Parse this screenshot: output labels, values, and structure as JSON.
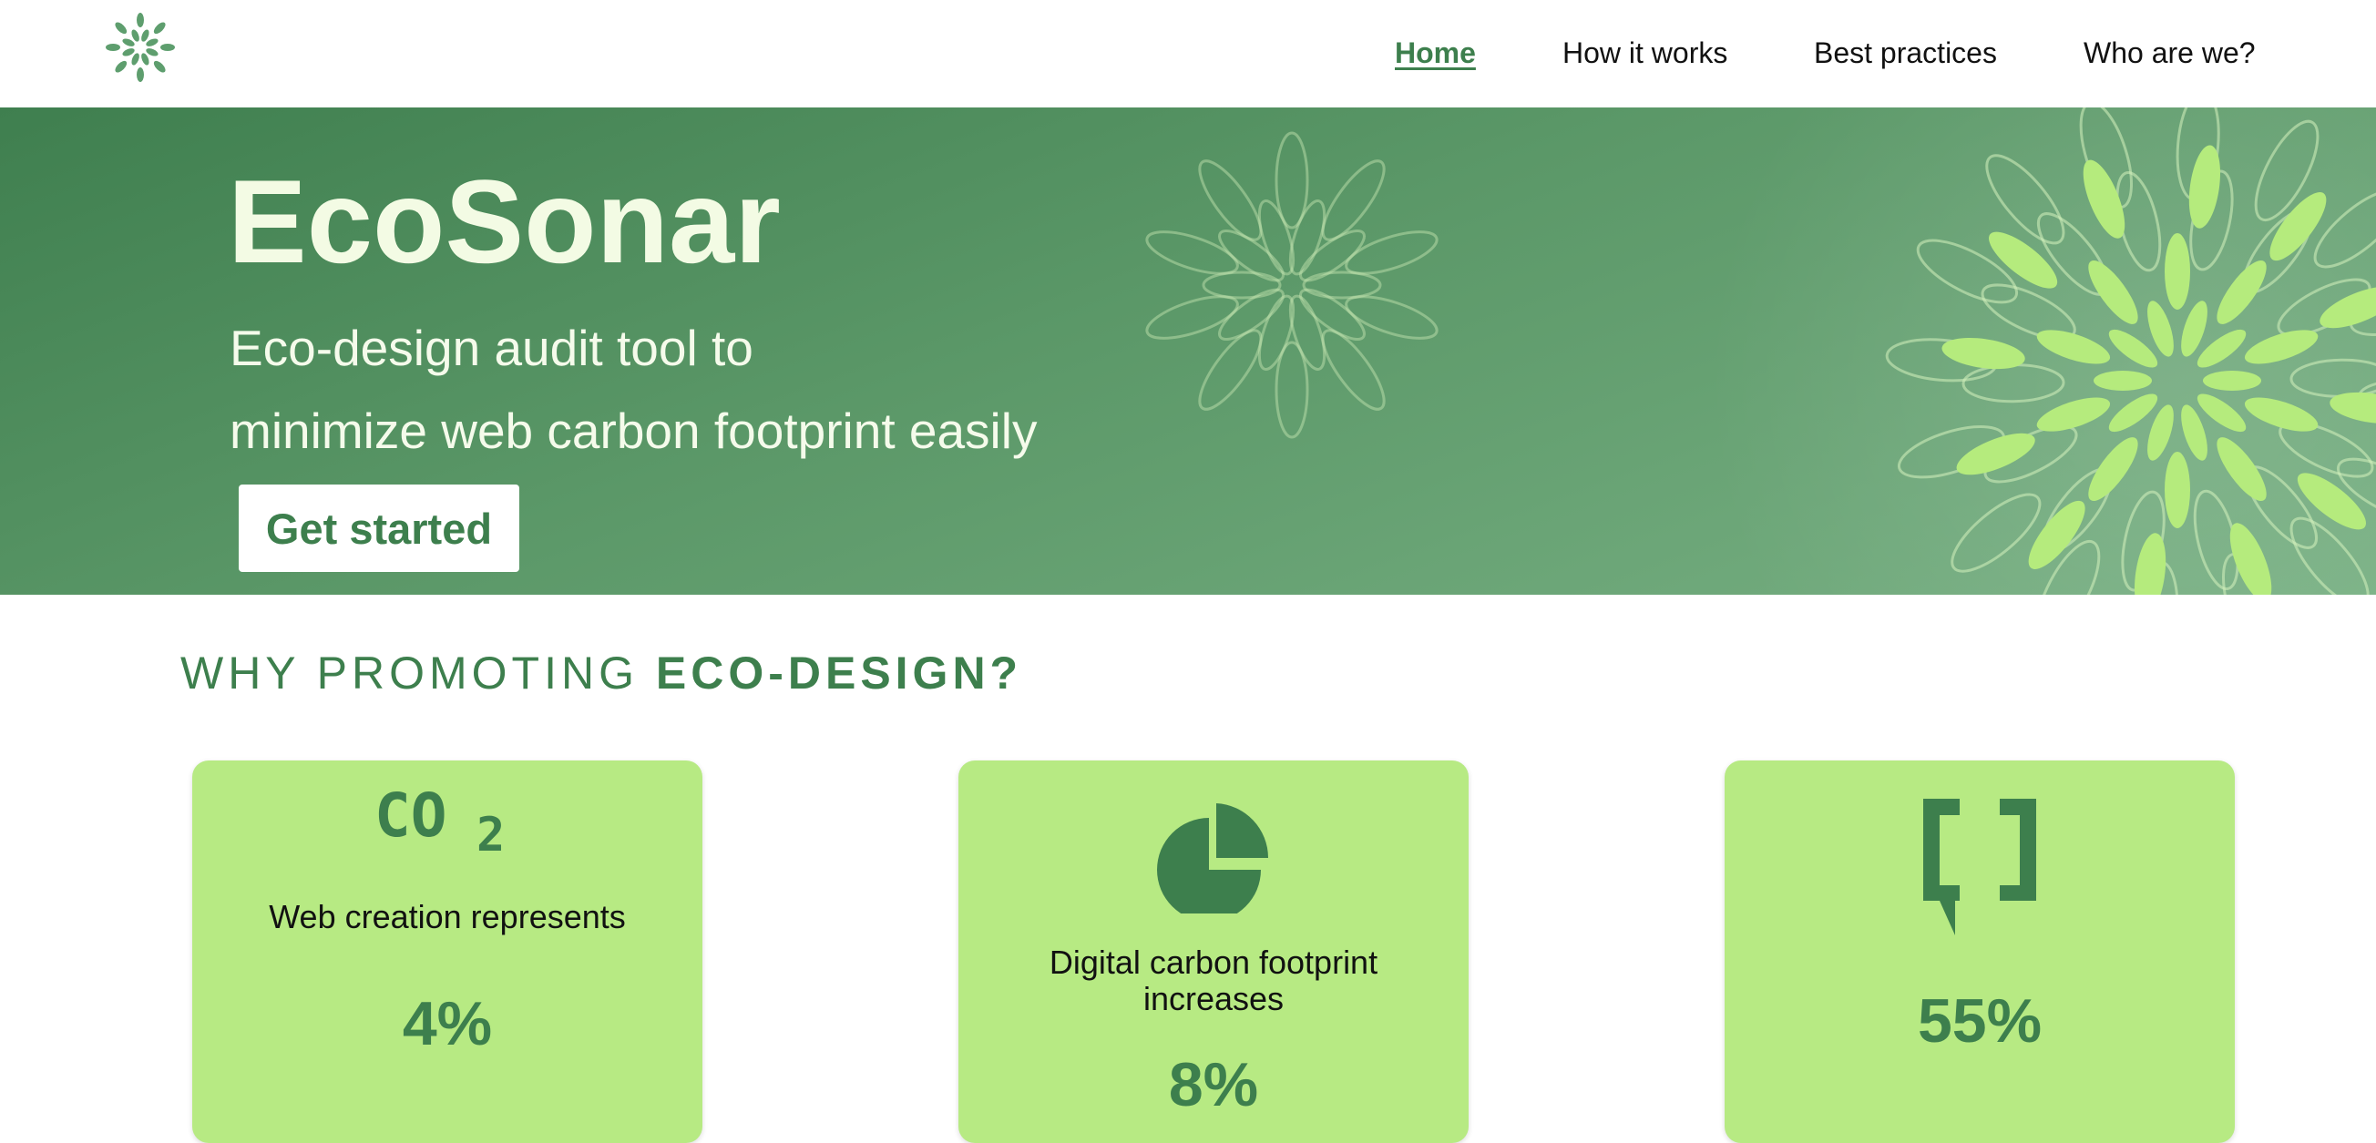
{
  "nav": {
    "logo_icon": "leaf-flower-logo",
    "links": [
      {
        "label": "Home",
        "active": true
      },
      {
        "label": "How it works",
        "active": false
      },
      {
        "label": "Best practices",
        "active": false
      },
      {
        "label": "Who are we?",
        "active": false
      }
    ]
  },
  "hero": {
    "title": "EcoSonar",
    "subtitle_line1": "Eco-design audit tool to",
    "subtitle_line2": "minimize web carbon footprint easily",
    "cta_label": "Get started"
  },
  "section": {
    "title_regular": "WHY PROMOTING ",
    "title_bold": "ECO-DESIGN?"
  },
  "cards": [
    {
      "icon": "co2-icon",
      "icon_text": "CO",
      "icon_sub": "2",
      "label": "Web creation represents",
      "value": "4%"
    },
    {
      "icon": "pie-chart-icon",
      "label": "Digital carbon footprint increases",
      "value": "8%"
    },
    {
      "icon": "speech-bracket-icon",
      "label": "",
      "value": "55%"
    }
  ],
  "colors": {
    "brand_green": "#3d7f4d",
    "card_green": "#b7ea83",
    "hero_text": "#f3fbe4",
    "leaf_light": "#b5eb7d"
  }
}
